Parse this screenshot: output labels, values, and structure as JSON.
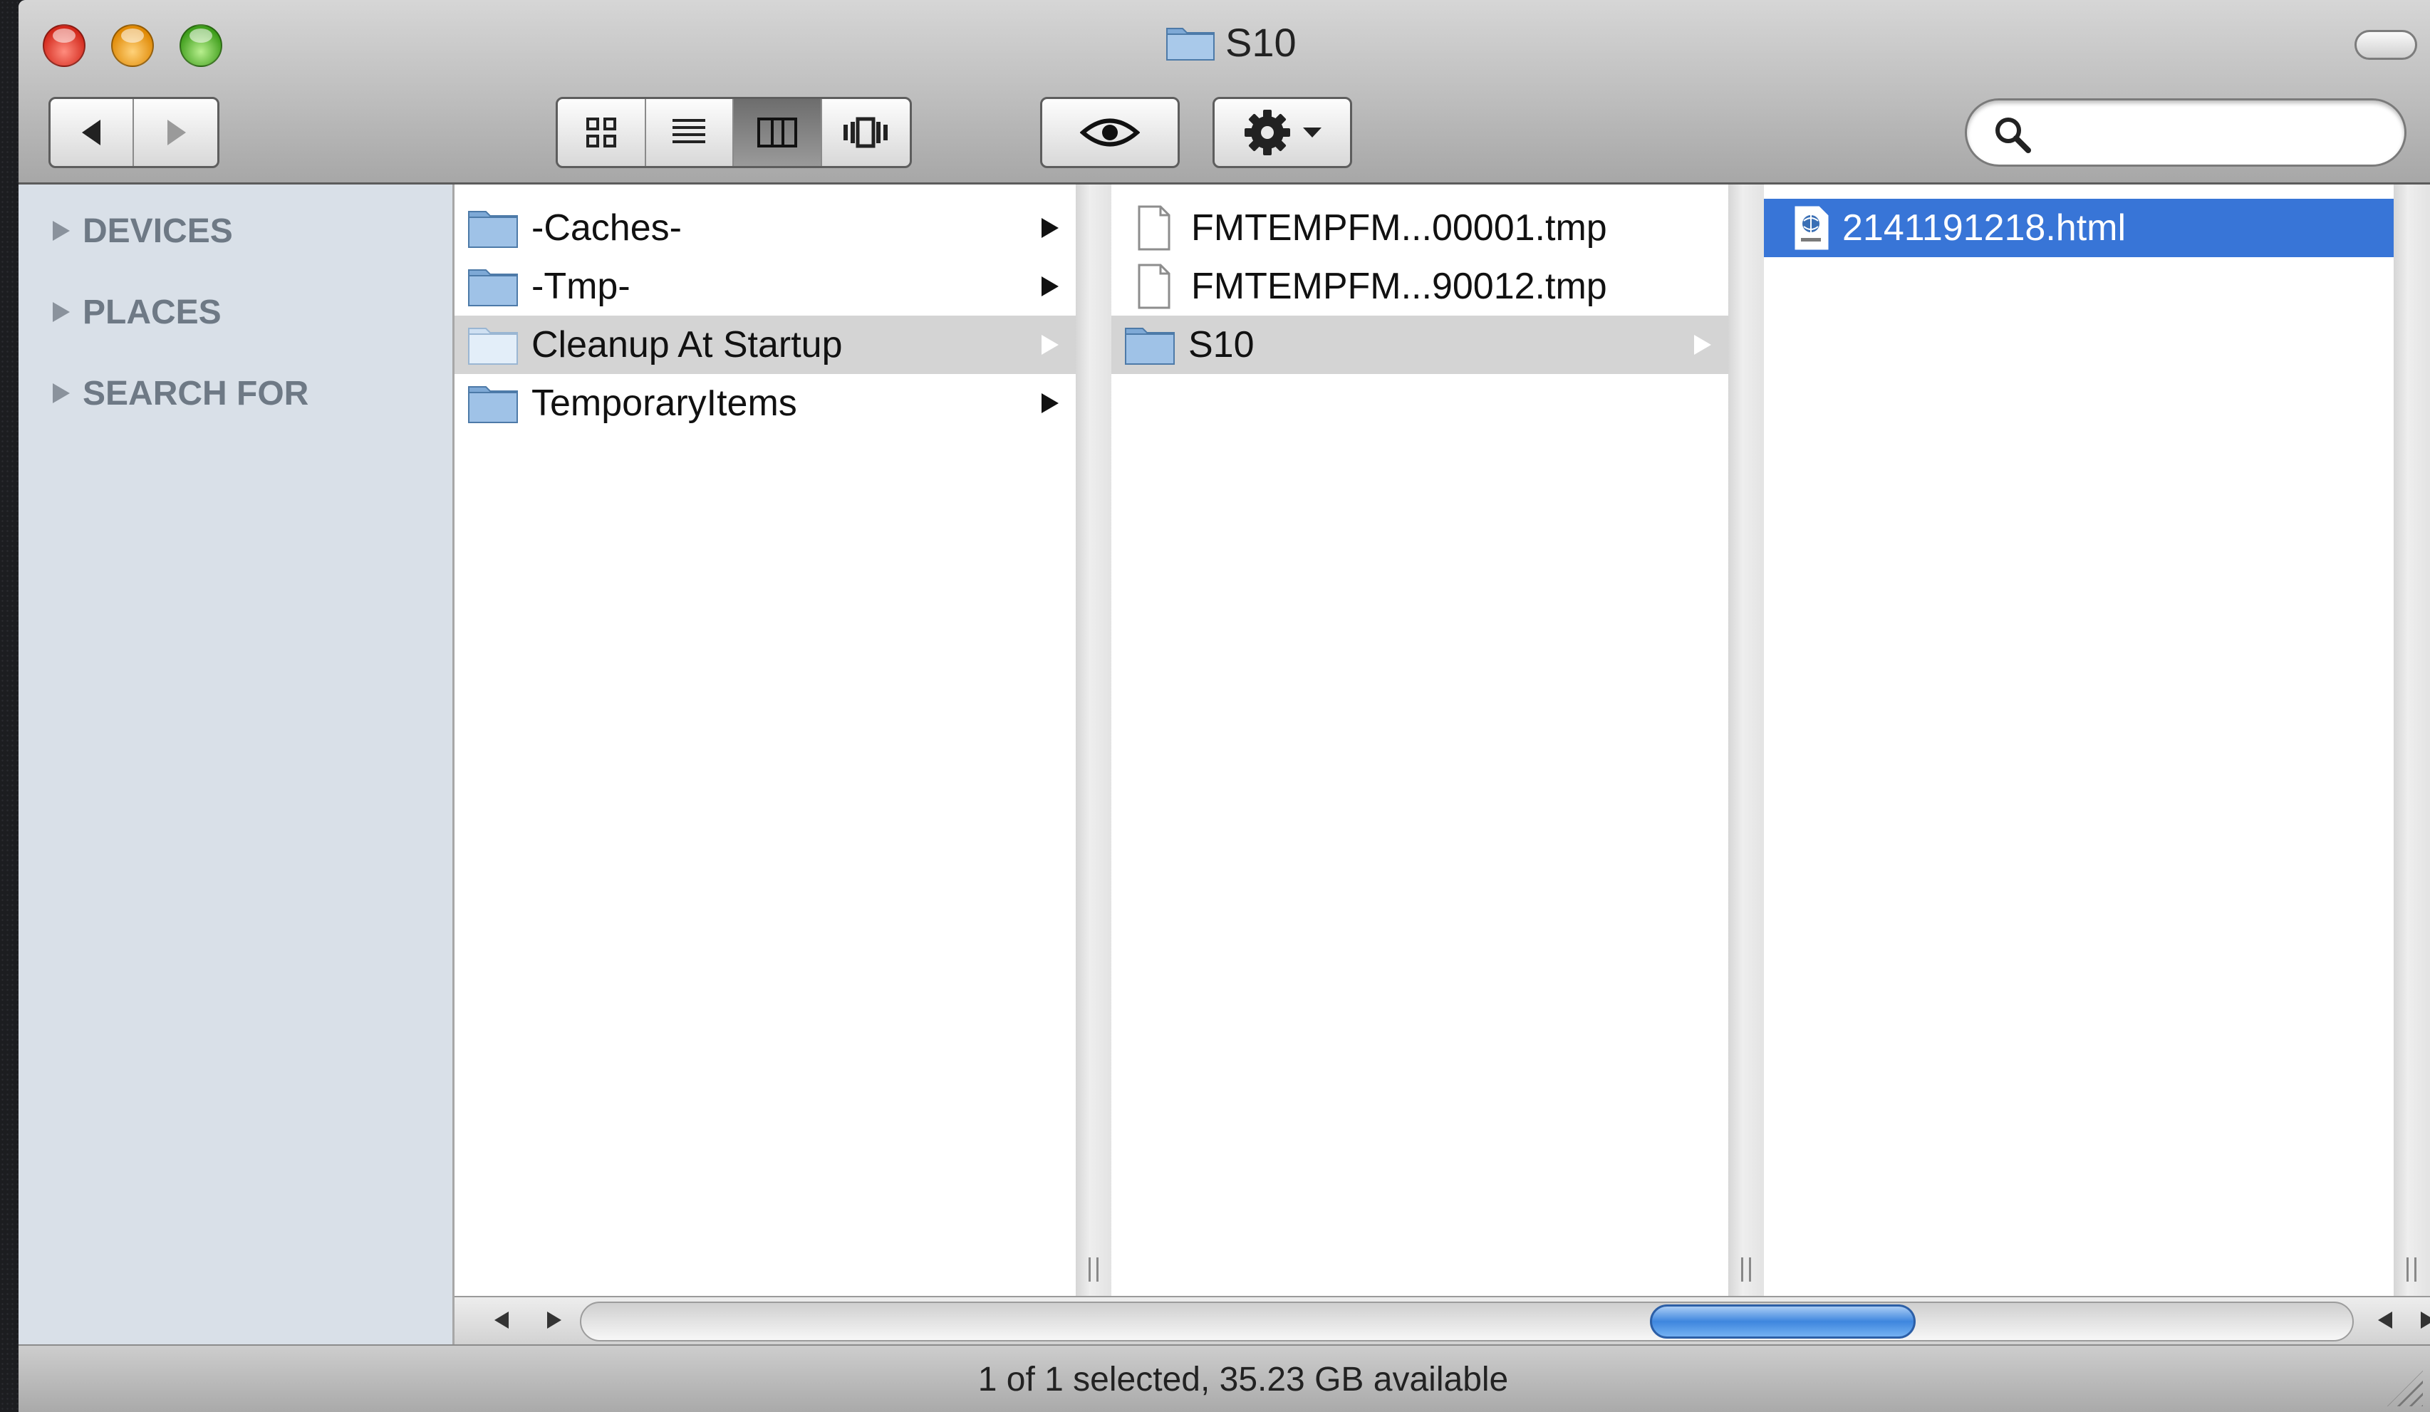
{
  "window": {
    "title": "S10"
  },
  "toolbar": {
    "back_icon": "left-triangle",
    "forward_icon": "right-triangle",
    "view_modes": [
      "icon-view",
      "list-view",
      "column-view",
      "coverflow-view"
    ],
    "active_view": "column-view",
    "quicklook_icon": "eye-icon",
    "action_icon": "gear-icon",
    "search": {
      "value": "",
      "placeholder": ""
    }
  },
  "sidebar": {
    "sections": [
      {
        "label": "DEVICES"
      },
      {
        "label": "PLACES"
      },
      {
        "label": "SEARCH FOR"
      }
    ]
  },
  "columns": {
    "col1": [
      {
        "name": "-Caches-",
        "kind": "folder",
        "has_children": true,
        "state": "none"
      },
      {
        "name": "-Tmp-",
        "kind": "folder",
        "has_children": true,
        "state": "none"
      },
      {
        "name": "Cleanup At Startup",
        "kind": "folder",
        "has_children": true,
        "state": "path"
      },
      {
        "name": "TemporaryItems",
        "kind": "folder",
        "has_children": true,
        "state": "none"
      }
    ],
    "col2": [
      {
        "name": "FMTEMPFM...00001.tmp",
        "kind": "file",
        "has_children": false,
        "state": "none"
      },
      {
        "name": "FMTEMPFM...90012.tmp",
        "kind": "file",
        "has_children": false,
        "state": "none"
      },
      {
        "name": "S10",
        "kind": "folder",
        "has_children": true,
        "state": "path"
      }
    ],
    "col3": [
      {
        "name": "2141191218.html",
        "kind": "html",
        "has_children": false,
        "state": "selected"
      }
    ]
  },
  "scroll": {
    "horizontal_position": 0.71,
    "visible_fraction": 0.15
  },
  "status": {
    "text": "1 of 1 selected, 35.23 GB available"
  },
  "colors": {
    "selection_blue": "#3875d7",
    "path_grey": "#d4d4d4",
    "sidebar_bg": "#d9e0e8",
    "folder_blue": "#8fb7e0"
  }
}
